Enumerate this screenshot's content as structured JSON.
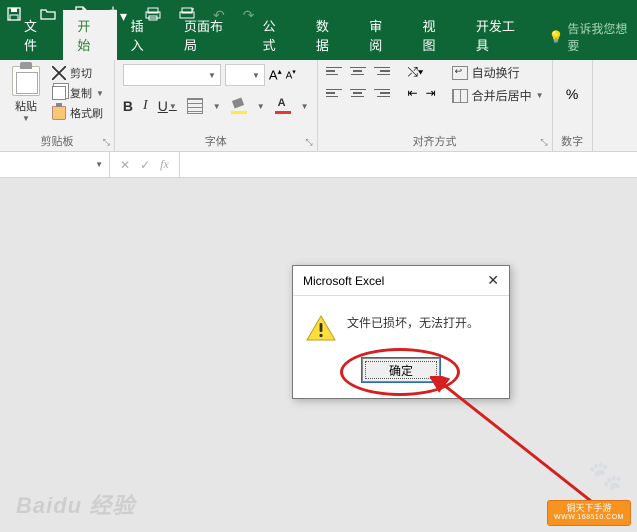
{
  "qat": {
    "undo": "↶",
    "redo": "↷"
  },
  "tabs": {
    "file": "文件",
    "home": "开始",
    "insert": "插入",
    "layout": "页面布局",
    "formulas": "公式",
    "data": "数据",
    "review": "审阅",
    "view": "视图",
    "developer": "开发工具",
    "tellme": "告诉我您想要"
  },
  "ribbon": {
    "clipboard": {
      "paste": "粘贴",
      "cut": "剪切",
      "copy": "复制",
      "format_painter": "格式刷",
      "group_label": "剪贴板"
    },
    "font": {
      "name": "",
      "size": "",
      "bold": "B",
      "italic": "I",
      "underline": "U",
      "group_label": "字体"
    },
    "alignment": {
      "wrap": "自动换行",
      "merge": "合并后居中",
      "group_label": "对齐方式"
    },
    "number": {
      "percent": "%",
      "group_label": "数字"
    }
  },
  "formula_bar": {
    "name_box": "",
    "cancel": "✕",
    "enter": "✓",
    "fx": "fx"
  },
  "dialog": {
    "title": "Microsoft Excel",
    "message": "文件已损坏，无法打开。",
    "ok": "确定"
  },
  "watermark": {
    "baidu": "Baidu 经验",
    "site_name": "铜天下手游",
    "site_url": "WWW.168510.COM"
  }
}
